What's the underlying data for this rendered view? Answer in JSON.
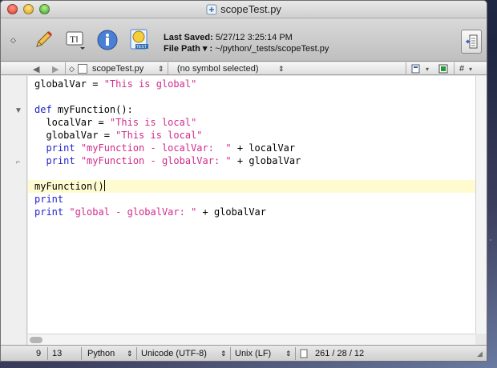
{
  "window": {
    "title": "scopeTest.py"
  },
  "toolbar": {
    "last_saved_label": "Last Saved:",
    "last_saved_value": "5/27/12 3:25:14 PM",
    "file_path_label": "File Path ▾ :",
    "file_path_value": "~/python/_tests/scopeTest.py"
  },
  "navbar": {
    "file_name": "scopeTest.py",
    "symbol": "(no symbol selected)",
    "hash": "#"
  },
  "code": {
    "lines": [
      {
        "parts": [
          {
            "t": "globalVar = ",
            "c": "plain"
          },
          {
            "t": "\"This is global\"",
            "c": "str"
          }
        ]
      },
      {
        "parts": []
      },
      {
        "parts": [
          {
            "t": "def",
            "c": "kw"
          },
          {
            "t": " myFunction():",
            "c": "plain"
          }
        ]
      },
      {
        "parts": [
          {
            "t": "  localVar = ",
            "c": "plain"
          },
          {
            "t": "\"This is local\"",
            "c": "str"
          }
        ]
      },
      {
        "parts": [
          {
            "t": "  globalVar = ",
            "c": "plain"
          },
          {
            "t": "\"This is local\"",
            "c": "str"
          }
        ]
      },
      {
        "parts": [
          {
            "t": "  print",
            "c": "kw"
          },
          {
            "t": " ",
            "c": "plain"
          },
          {
            "t": "\"myFunction - localVar:  \"",
            "c": "str"
          },
          {
            "t": " + localVar",
            "c": "plain"
          }
        ]
      },
      {
        "parts": [
          {
            "t": "  print",
            "c": "kw"
          },
          {
            "t": " ",
            "c": "plain"
          },
          {
            "t": "\"myFunction - globalVar: \"",
            "c": "str"
          },
          {
            "t": " + globalVar",
            "c": "plain"
          }
        ]
      },
      {
        "parts": []
      },
      {
        "parts": [
          {
            "t": "myFunction()",
            "c": "plain"
          }
        ],
        "current": true
      },
      {
        "parts": [
          {
            "t": "print",
            "c": "kw"
          }
        ]
      },
      {
        "parts": [
          {
            "t": "print",
            "c": "kw"
          },
          {
            "t": " ",
            "c": "plain"
          },
          {
            "t": "\"global - globalVar: \"",
            "c": "str"
          },
          {
            "t": " + globalVar",
            "c": "plain"
          }
        ]
      }
    ]
  },
  "status": {
    "line": "9",
    "column": "13",
    "language": "Python",
    "encoding": "Unicode (UTF-8)",
    "line_endings": "Unix (LF)",
    "counts": "261 / 28 / 12"
  },
  "colors": {
    "keyword": "#1f1fc8",
    "string": "#d02b8a",
    "current_line": "#fffbd0"
  }
}
